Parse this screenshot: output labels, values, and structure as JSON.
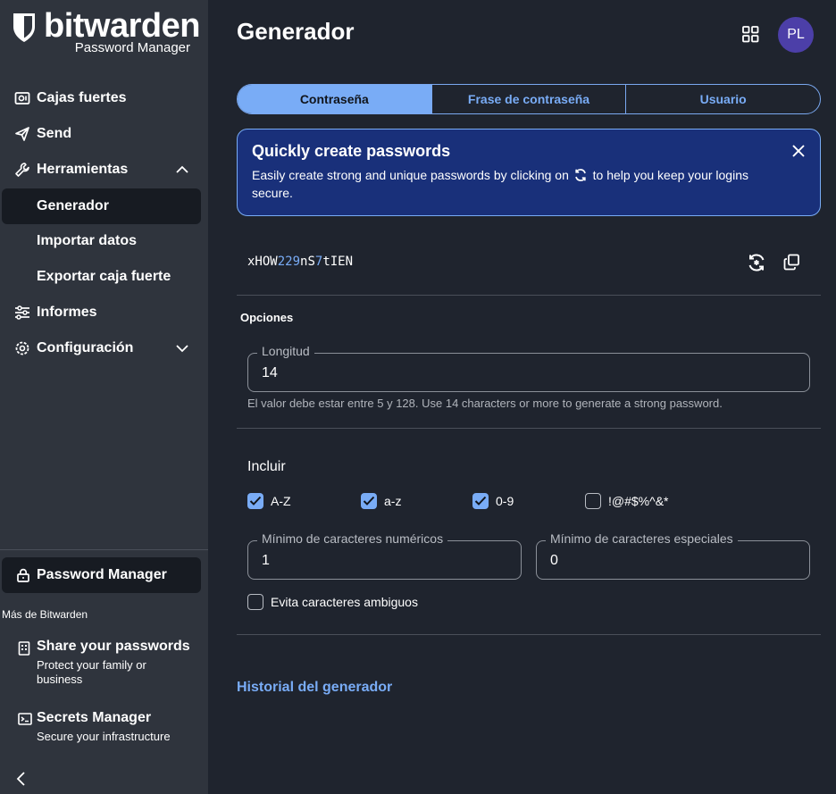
{
  "brand": {
    "name": "bitwarden",
    "sub": "Password Manager"
  },
  "sidebar": {
    "items": [
      {
        "label": "Cajas fuertes",
        "icon": "vault-icon"
      },
      {
        "label": "Send",
        "icon": "send-icon"
      },
      {
        "label": "Herramientas",
        "icon": "wrench-icon"
      },
      {
        "label": "Generador"
      },
      {
        "label": "Importar datos"
      },
      {
        "label": "Exportar caja fuerte"
      },
      {
        "label": "Informes",
        "icon": "sliders-icon"
      },
      {
        "label": "Configuración",
        "icon": "gear-icon"
      }
    ],
    "product": "Password Manager",
    "more_label": "Más de Bitwarden",
    "promos": [
      {
        "title": "Share your passwords",
        "desc": "Protect your family or business"
      },
      {
        "title": "Secrets Manager",
        "desc": "Secure your infrastructure"
      }
    ]
  },
  "header": {
    "title": "Generador",
    "avatar": "PL"
  },
  "tabs": [
    {
      "label": "Contraseña",
      "active": true
    },
    {
      "label": "Frase de contraseña",
      "active": false
    },
    {
      "label": "Usuario",
      "active": false
    }
  ],
  "callout": {
    "title": "Quickly create passwords",
    "body_pre": "Easily create strong and unique passwords by clicking on",
    "body_post": "to help you keep your logins secure."
  },
  "password": {
    "parts": [
      {
        "t": "xHOW",
        "num": false
      },
      {
        "t": "229",
        "num": true
      },
      {
        "t": "nS",
        "num": false
      },
      {
        "t": "7",
        "num": true
      },
      {
        "t": "tIEN",
        "num": false
      }
    ]
  },
  "options": {
    "label": "Opciones",
    "length_label": "Longitud",
    "length_value": "14",
    "hint": "El valor debe estar entre 5 y 128. Use 14 characters or more to generate a strong password.",
    "include_label": "Incluir",
    "checks": [
      {
        "label": "A-Z",
        "checked": true
      },
      {
        "label": "a-z",
        "checked": true
      },
      {
        "label": "0-9",
        "checked": true
      },
      {
        "label": "!@#$%^&*",
        "checked": false
      }
    ],
    "min_numbers_label": "Mínimo de caracteres numéricos",
    "min_numbers_value": "1",
    "min_special_label": "Mínimo de caracteres especiales",
    "min_special_value": "0",
    "avoid_ambiguous_label": "Evita caracteres ambiguos",
    "avoid_ambiguous_checked": false
  },
  "history_link": "Historial del generador",
  "colors": {
    "accent": "#79acf6",
    "sidebar_bg": "#2f343d",
    "main_bg": "#1f242e",
    "callout_bg": "#19307a"
  }
}
